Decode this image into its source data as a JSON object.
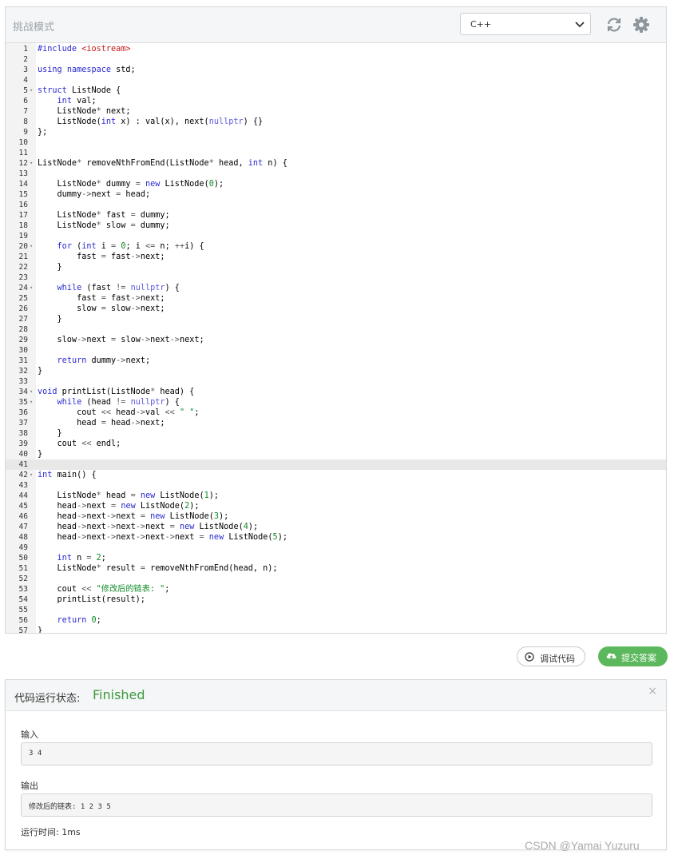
{
  "toolbar": {
    "title": "挑战模式",
    "language": "C++"
  },
  "colors": {
    "accent_green": "#5cb85c",
    "status_green": "#3c9a3c"
  },
  "icons": {
    "chevron": "chevron-down-icon",
    "refresh": "refresh-icon",
    "settings": "gear-icon",
    "debug": "play-circle-icon",
    "submit": "cloud-upload-icon",
    "close": "close-icon"
  },
  "editor": {
    "active_line": 41,
    "lines": [
      {
        "n": "1",
        "t": "#include <iostream>"
      },
      {
        "n": "2",
        "t": ""
      },
      {
        "n": "3",
        "t": "using namespace std;"
      },
      {
        "n": "4",
        "t": ""
      },
      {
        "n": "5",
        "t": "struct ListNode {",
        "fold": true
      },
      {
        "n": "6",
        "t": "    int val;"
      },
      {
        "n": "7",
        "t": "    ListNode* next;"
      },
      {
        "n": "8",
        "t": "    ListNode(int x) : val(x), next(nullptr) {}"
      },
      {
        "n": "9",
        "t": "};"
      },
      {
        "n": "10",
        "t": ""
      },
      {
        "n": "11",
        "t": ""
      },
      {
        "n": "12",
        "t": "ListNode* removeNthFromEnd(ListNode* head, int n) {",
        "fold": true
      },
      {
        "n": "13",
        "t": ""
      },
      {
        "n": "14",
        "t": "    ListNode* dummy = new ListNode(0);"
      },
      {
        "n": "15",
        "t": "    dummy->next = head;"
      },
      {
        "n": "16",
        "t": ""
      },
      {
        "n": "17",
        "t": "    ListNode* fast = dummy;"
      },
      {
        "n": "18",
        "t": "    ListNode* slow = dummy;"
      },
      {
        "n": "19",
        "t": ""
      },
      {
        "n": "20",
        "t": "    for (int i = 0; i <= n; ++i) {",
        "fold": true
      },
      {
        "n": "21",
        "t": "        fast = fast->next;"
      },
      {
        "n": "22",
        "t": "    }"
      },
      {
        "n": "23",
        "t": ""
      },
      {
        "n": "24",
        "t": "    while (fast != nullptr) {",
        "fold": true
      },
      {
        "n": "25",
        "t": "        fast = fast->next;"
      },
      {
        "n": "26",
        "t": "        slow = slow->next;"
      },
      {
        "n": "27",
        "t": "    }"
      },
      {
        "n": "28",
        "t": ""
      },
      {
        "n": "29",
        "t": "    slow->next = slow->next->next;"
      },
      {
        "n": "30",
        "t": ""
      },
      {
        "n": "31",
        "t": "    return dummy->next;"
      },
      {
        "n": "32",
        "t": "}"
      },
      {
        "n": "33",
        "t": ""
      },
      {
        "n": "34",
        "t": "void printList(ListNode* head) {",
        "fold": true
      },
      {
        "n": "35",
        "t": "    while (head != nullptr) {",
        "fold": true
      },
      {
        "n": "36",
        "t": "        cout << head->val << \" \";"
      },
      {
        "n": "37",
        "t": "        head = head->next;"
      },
      {
        "n": "38",
        "t": "    }"
      },
      {
        "n": "39",
        "t": "    cout << endl;"
      },
      {
        "n": "40",
        "t": "}"
      },
      {
        "n": "41",
        "t": ""
      },
      {
        "n": "42",
        "t": "int main() {",
        "fold": true
      },
      {
        "n": "43",
        "t": ""
      },
      {
        "n": "44",
        "t": "    ListNode* head = new ListNode(1);"
      },
      {
        "n": "45",
        "t": "    head->next = new ListNode(2);"
      },
      {
        "n": "46",
        "t": "    head->next->next = new ListNode(3);"
      },
      {
        "n": "47",
        "t": "    head->next->next->next = new ListNode(4);"
      },
      {
        "n": "48",
        "t": "    head->next->next->next->next = new ListNode(5);"
      },
      {
        "n": "49",
        "t": ""
      },
      {
        "n": "50",
        "t": "    int n = 2;"
      },
      {
        "n": "51",
        "t": "    ListNode* result = removeNthFromEnd(head, n);"
      },
      {
        "n": "52",
        "t": ""
      },
      {
        "n": "53",
        "t": "    cout << \"修改后的链表: \";"
      },
      {
        "n": "54",
        "t": "    printList(result);"
      },
      {
        "n": "55",
        "t": ""
      },
      {
        "n": "56",
        "t": "    return 0;"
      },
      {
        "n": "57",
        "t": "}"
      }
    ]
  },
  "actions": {
    "debug_label": "调试代码",
    "submit_label": "提交答案"
  },
  "result": {
    "status_label": "代码运行状态:",
    "status_value": "Finished",
    "close": "×",
    "input_label": "输入",
    "input_value": "3 4",
    "output_label": "输出",
    "output_value": "修改后的链表: 1 2 3 5",
    "runtime_text": "运行时间: 1ms"
  },
  "watermark": "CSDN @Yamai Yuzuru"
}
